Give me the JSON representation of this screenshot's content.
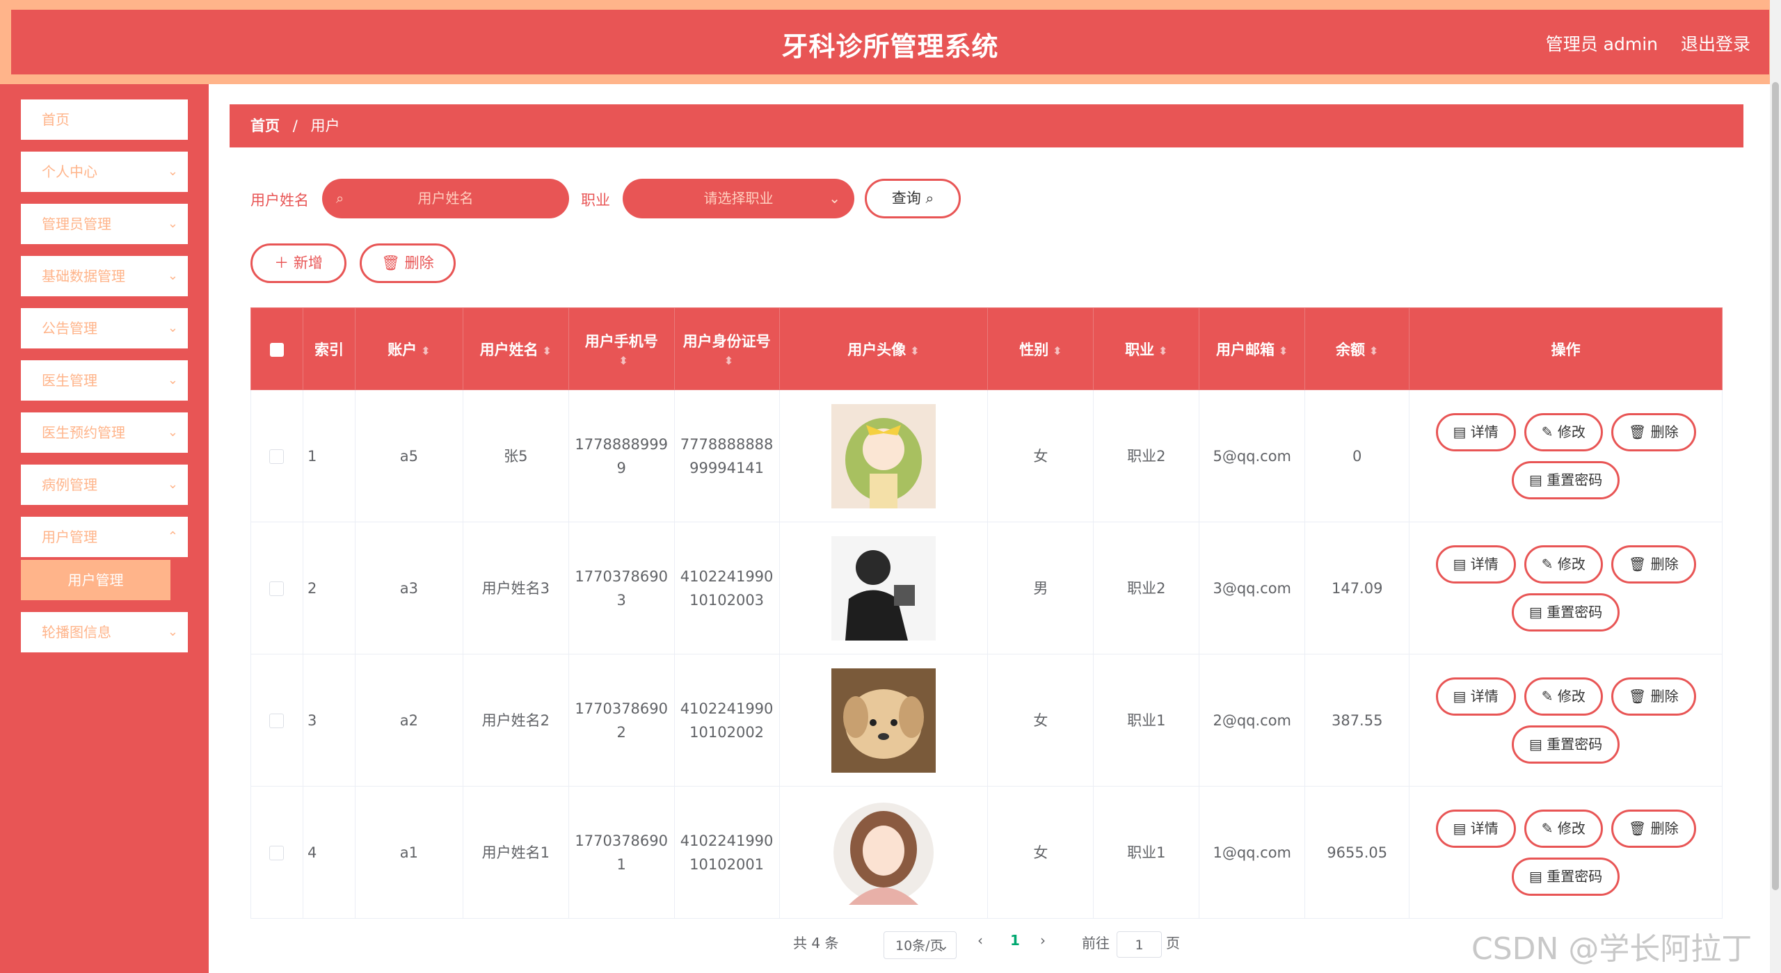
{
  "header": {
    "title": "牙科诊所管理系统",
    "admin": "管理员 admin",
    "logout": "退出登录"
  },
  "sidebar": {
    "items": [
      {
        "label": "首页"
      },
      {
        "label": "个人中心"
      },
      {
        "label": "管理员管理"
      },
      {
        "label": "基础数据管理"
      },
      {
        "label": "公告管理"
      },
      {
        "label": "医生管理"
      },
      {
        "label": "医生预约管理"
      },
      {
        "label": "病例管理"
      },
      {
        "label": "用户管理"
      },
      {
        "label": "轮播图信息"
      }
    ],
    "submenu": {
      "label": "用户管理"
    }
  },
  "breadcrumb": {
    "home": "首页",
    "separator": "/",
    "current": "用户"
  },
  "search": {
    "name_label": "用户姓名",
    "name_placeholder": "用户姓名",
    "job_label": "职业",
    "job_placeholder": "请选择职业",
    "query_label": "查询"
  },
  "actions": {
    "add_label": "新增",
    "delete_label": "删除"
  },
  "table": {
    "headers": {
      "index": "索引",
      "account": "账户",
      "name": "用户姓名",
      "phone": "用户手机号",
      "idcard": "用户身份证号",
      "avatar": "用户头像",
      "gender": "性别",
      "job": "职业",
      "email": "用户邮箱",
      "balance": "余额",
      "ops": "操作"
    },
    "rows": [
      {
        "index": "1",
        "account": "a5",
        "name": "张5",
        "phone": "17788889999",
        "idcard": "777888888899994141",
        "avatar": "girl-yellow-bow-avatar",
        "gender": "女",
        "job": "职业2",
        "email": "5@qq.com",
        "balance": "0"
      },
      {
        "index": "2",
        "account": "a3",
        "name": "用户姓名3",
        "phone": "17703786903",
        "idcard": "410224199010102003",
        "avatar": "man-silhouette-avatar",
        "gender": "男",
        "job": "职业2",
        "email": "3@qq.com",
        "balance": "147.09"
      },
      {
        "index": "3",
        "account": "a2",
        "name": "用户姓名2",
        "phone": "17703786902",
        "idcard": "410224199010102002",
        "avatar": "puppy-avatar",
        "gender": "女",
        "job": "职业1",
        "email": "2@qq.com",
        "balance": "387.55"
      },
      {
        "index": "4",
        "account": "a1",
        "name": "用户姓名1",
        "phone": "17703786901",
        "idcard": "410224199010102001",
        "avatar": "girl-portrait-avatar",
        "gender": "女",
        "job": "职业1",
        "email": "1@qq.com",
        "balance": "9655.05"
      }
    ],
    "row_actions": {
      "detail": "详情",
      "edit": "修改",
      "delete": "删除",
      "reset": "重置密码"
    }
  },
  "pagination": {
    "total": "共 4 条",
    "page_size": "10条/页",
    "current_page": "1",
    "goto_prefix": "前往",
    "goto_value": "1",
    "goto_suffix": "页"
  },
  "watermark": "CSDN @学长阿拉丁",
  "colors": {
    "primary": "#e85555",
    "accent": "#ffb48a"
  }
}
